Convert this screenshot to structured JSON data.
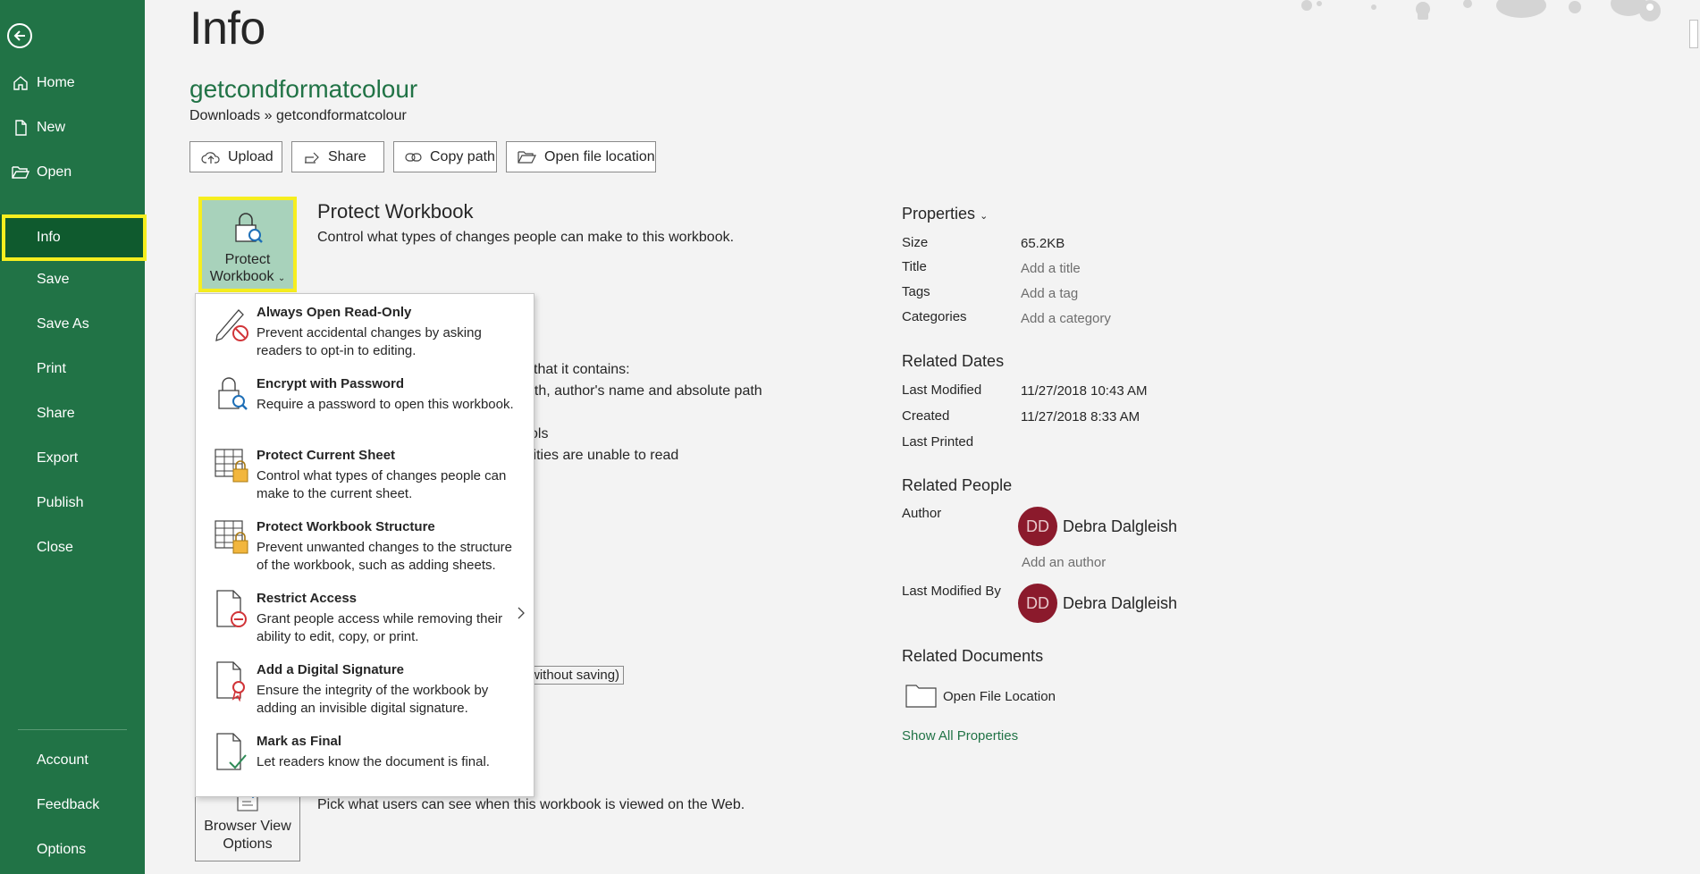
{
  "sidebar": {
    "back_icon": "back-arrow-icon",
    "items": [
      {
        "label": "Home",
        "icon": "home-icon"
      },
      {
        "label": "New",
        "icon": "new-document-icon"
      },
      {
        "label": "Open",
        "icon": "folder-open-icon"
      },
      {
        "label": "Info"
      },
      {
        "label": "Save"
      },
      {
        "label": "Save As"
      },
      {
        "label": "Print"
      },
      {
        "label": "Share"
      },
      {
        "label": "Export"
      },
      {
        "label": "Publish"
      },
      {
        "label": "Close"
      }
    ],
    "bottom_items": [
      {
        "label": "Account"
      },
      {
        "label": "Feedback"
      },
      {
        "label": "Options"
      }
    ],
    "active": "Info"
  },
  "page": {
    "title": "Info",
    "file_name": "getcondformatcolour",
    "file_path": "Downloads » getcondformatcolour"
  },
  "actions": {
    "upload": "Upload",
    "share": "Share",
    "copy_path": "Copy path",
    "open_file_location": "Open file location"
  },
  "protect": {
    "button_line1": "Protect",
    "button_line2": "Workbook",
    "title": "Protect Workbook",
    "desc": "Control what types of changes people can make to this workbook."
  },
  "inspect_partial": {
    "line1": "that it contains:",
    "line2": "ath, author's name and absolute path",
    "line3": "ols",
    "line4": "lities are unable to read",
    "box": "without saving)"
  },
  "browser_view": {
    "button_line1": "Browser View",
    "button_line2": "Options",
    "desc": "Pick what users can see when this workbook is viewed on the Web."
  },
  "dropdown": {
    "items": [
      {
        "title": "Always Open Read-Only",
        "desc": "Prevent accidental changes by asking readers to opt-in to editing.",
        "icon": "pencil-prohibited-icon"
      },
      {
        "title": "Encrypt with Password",
        "desc": "Require a password to open this workbook.",
        "icon": "lock-key-icon"
      },
      {
        "title": "Protect Current Sheet",
        "desc": "Control what types of changes people can make to the current sheet.",
        "icon": "sheet-lock-icon"
      },
      {
        "title": "Protect Workbook Structure",
        "desc": "Prevent unwanted changes to the structure of the workbook, such as adding sheets.",
        "icon": "workbook-lock-icon"
      },
      {
        "title": "Restrict Access",
        "desc": "Grant people access while removing their ability to edit, copy, or print.",
        "icon": "document-restricted-icon"
      },
      {
        "title": "Add a Digital Signature",
        "desc": "Ensure the integrity of the workbook by adding an invisible digital signature.",
        "icon": "document-ribbon-icon"
      },
      {
        "title": "Mark as Final",
        "desc": "Let readers know the document is final.",
        "icon": "document-check-icon"
      }
    ]
  },
  "properties": {
    "heading": "Properties",
    "rows": [
      {
        "label": "Size",
        "value": "65.2KB"
      },
      {
        "label": "Title",
        "placeholder": "Add a title"
      },
      {
        "label": "Tags",
        "placeholder": "Add a tag"
      },
      {
        "label": "Categories",
        "placeholder": "Add a category"
      }
    ]
  },
  "related_dates": {
    "heading": "Related Dates",
    "rows": [
      {
        "label": "Last Modified",
        "value": "11/27/2018 10:43 AM"
      },
      {
        "label": "Created",
        "value": "11/27/2018 8:33 AM"
      },
      {
        "label": "Last Printed",
        "value": ""
      }
    ]
  },
  "related_people": {
    "heading": "Related People",
    "author_label": "Author",
    "author_initials": "DD",
    "author_name": "Debra Dalgleish",
    "add_author": "Add an author",
    "modified_by_label": "Last Modified By",
    "modified_by_initials": "DD",
    "modified_by_name": "Debra Dalgleish"
  },
  "related_documents": {
    "heading": "Related Documents",
    "open_file_location": "Open File Location",
    "show_all": "Show All Properties"
  },
  "colors": {
    "brand_green": "#217346",
    "active_nav": "#0f5a2e",
    "highlight_yellow": "#f6ee1f",
    "avatar": "#8b1a2c"
  }
}
